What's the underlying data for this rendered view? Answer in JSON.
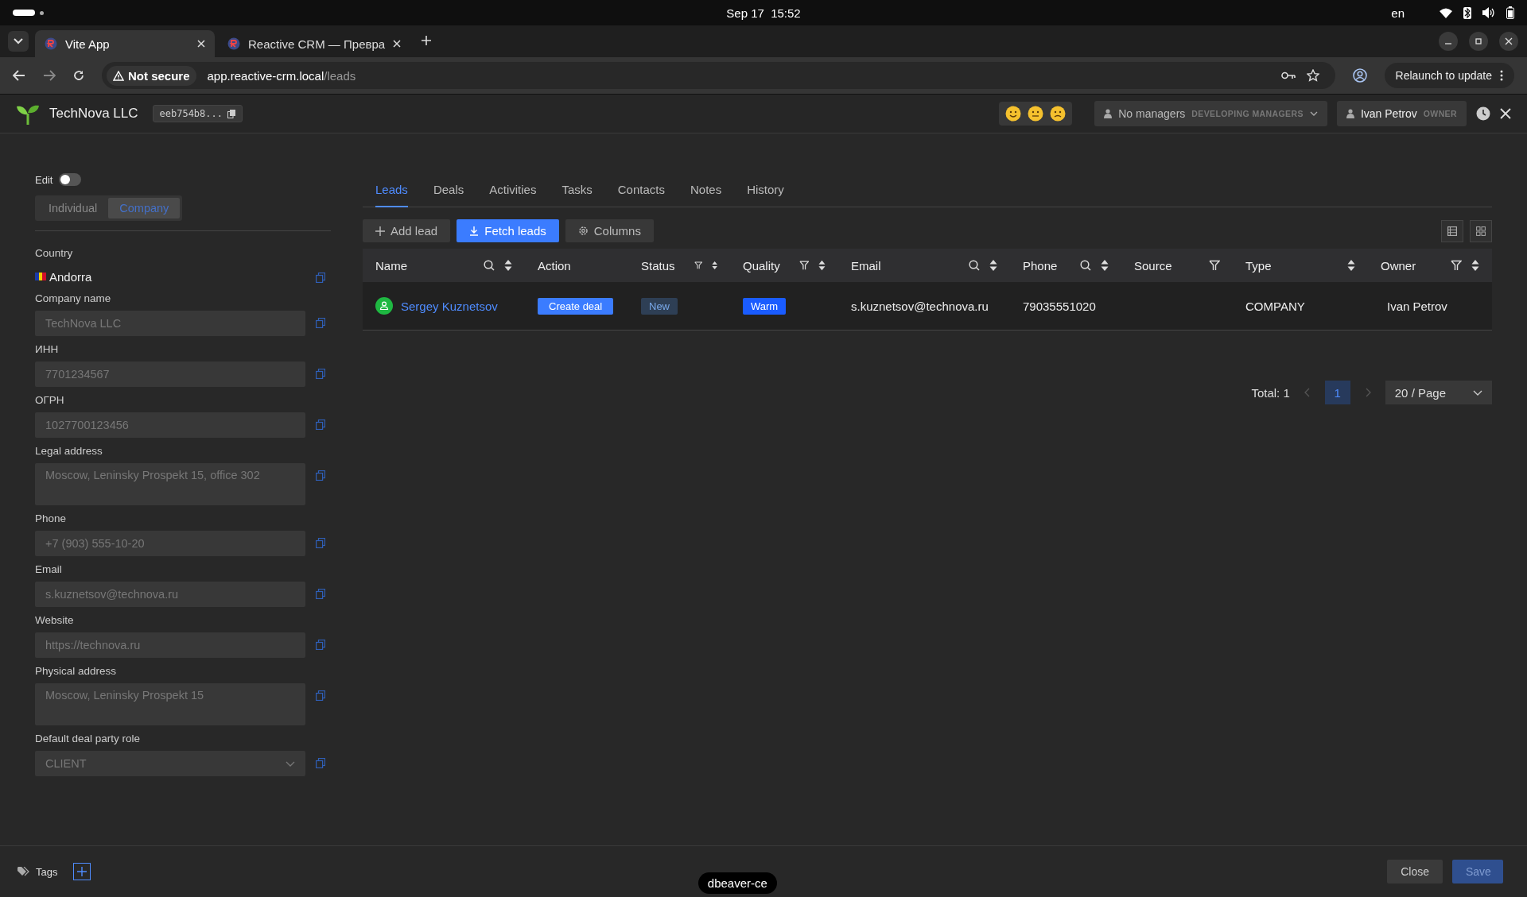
{
  "os_bar": {
    "date": "Sep 17",
    "time": "15:52",
    "language": "en"
  },
  "browser": {
    "tabs": [
      {
        "title": "Vite App",
        "selected": true
      },
      {
        "title": "Reactive CRM — Превра",
        "selected": false
      }
    ],
    "security": "Not secure",
    "url_host": "app.reactive-crm.local",
    "url_path": "/leads",
    "relaunch": "Relaunch to update"
  },
  "header": {
    "company": "TechNova LLC",
    "id": "eeb754b8...",
    "managers": "No managers",
    "managers_note": "DEVELOPING MANAGERS",
    "user": "Ivan Petrov",
    "user_role": "OWNER"
  },
  "sidebar": {
    "edit_label": "Edit",
    "edit_on": false,
    "party_types": [
      {
        "label": "Individual",
        "selected": false
      },
      {
        "label": "Company",
        "selected": true
      }
    ],
    "fields": [
      {
        "kind": "country",
        "label": "Country",
        "value": "Andorra"
      },
      {
        "kind": "text",
        "label": "Company name",
        "value": "TechNova LLC"
      },
      {
        "kind": "text",
        "label": "ИНН",
        "value": "7701234567"
      },
      {
        "kind": "text",
        "label": "ОГРН",
        "value": "1027700123456"
      },
      {
        "kind": "textarea",
        "label": "Legal address",
        "value": "Moscow, Leninsky Prospekt 15, office 302"
      },
      {
        "kind": "text",
        "label": "Phone",
        "value": "+7 (903) 555-10-20"
      },
      {
        "kind": "text",
        "label": "Email",
        "value": "s.kuznetsov@technova.ru"
      },
      {
        "kind": "text",
        "label": "Website",
        "value": "https://technova.ru"
      },
      {
        "kind": "textarea",
        "label": "Physical address",
        "value": "Moscow, Leninsky Prospekt 15"
      },
      {
        "kind": "select",
        "label": "Default deal party role",
        "value": "CLIENT"
      }
    ]
  },
  "tabs": [
    {
      "label": "Leads",
      "selected": true
    },
    {
      "label": "Deals",
      "selected": false
    },
    {
      "label": "Activities",
      "selected": false
    },
    {
      "label": "Tasks",
      "selected": false
    },
    {
      "label": "Contacts",
      "selected": false
    },
    {
      "label": "Notes",
      "selected": false
    },
    {
      "label": "History",
      "selected": false
    }
  ],
  "toolbar": [
    {
      "kind": "add",
      "label": "Add lead"
    },
    {
      "kind": "fetch",
      "label": "Fetch leads"
    },
    {
      "kind": "columns",
      "label": "Columns"
    }
  ],
  "table": {
    "columns": [
      {
        "label": "Name",
        "search": true,
        "filter": false,
        "sort": true
      },
      {
        "label": "Action",
        "search": false,
        "filter": false,
        "sort": false
      },
      {
        "label": "Status",
        "search": false,
        "filter": true,
        "sort": true
      },
      {
        "label": "Quality",
        "search": false,
        "filter": true,
        "sort": true
      },
      {
        "label": "Email",
        "search": true,
        "filter": false,
        "sort": true
      },
      {
        "label": "Phone",
        "search": true,
        "filter": false,
        "sort": true
      },
      {
        "label": "Source",
        "search": false,
        "filter": true,
        "sort": false
      },
      {
        "label": "Type",
        "search": false,
        "filter": false,
        "sort": true
      },
      {
        "label": "Owner",
        "search": false,
        "filter": true,
        "sort": true
      }
    ],
    "rows": [
      {
        "name": "Sergey Kuznetsov",
        "action": "Create deal",
        "status": "New",
        "quality": "Warm",
        "email": "s.kuznetsov@technova.ru",
        "phone": "79035551020",
        "type": "COMPANY",
        "owner": "Ivan Petrov"
      }
    ]
  },
  "pagination": {
    "total": "Total: 1",
    "pages": [
      {
        "label": "1",
        "selected": true
      }
    ],
    "page_size": "20 / Page"
  },
  "footer": {
    "tags": "Tags",
    "close": "Close",
    "save": "Save",
    "tooltip": "dbeaver-ce"
  }
}
